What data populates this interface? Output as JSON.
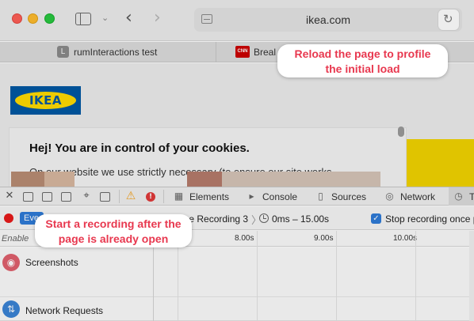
{
  "browser": {
    "url": "ikea.com",
    "icons": {
      "sidebar": "sidebar-icon",
      "back": "chevron-left-icon",
      "forward": "chevron-right-icon",
      "reload": "reload-icon",
      "page": "page-menu-icon"
    }
  },
  "tabs": [
    {
      "favicon_letter": "L",
      "label": "rumInteractions test"
    },
    {
      "favicon_text": "CNN",
      "label": "Breal"
    }
  ],
  "page": {
    "logo_text": "IKEA",
    "cookie_title": "Hej! You are in control of your cookies.",
    "cookie_body": "On our website we use strictly necessary (to ensure our site works",
    "brand_colors": {
      "blue": "#0058a3",
      "yellow": "#ffdb00"
    }
  },
  "inspector": {
    "tabs": [
      {
        "label": "Elements",
        "icon": "elements-icon"
      },
      {
        "label": "Console",
        "icon": "console-icon"
      },
      {
        "label": "Sources",
        "icon": "sources-icon"
      },
      {
        "label": "Network",
        "icon": "network-icon"
      },
      {
        "label": "T",
        "icon": "timelines-icon",
        "selected": true
      }
    ]
  },
  "timeline": {
    "events_label": "Eve",
    "recording_name": "ine Recording 3",
    "time_range": "0ms – 15.00s",
    "stop_recording_label": "Stop recording once p",
    "stop_recording_checked": true,
    "enable_label": "Enable",
    "ticks": [
      "8.00s",
      "9.00s",
      "10.00s"
    ],
    "rows": [
      {
        "label": "Screenshots",
        "icon": "camera-icon"
      },
      {
        "label": "Network Requests",
        "icon": "network-requests-icon"
      }
    ]
  },
  "callouts": {
    "reload": "Reload the page to profile the initial load",
    "start_recording": "Start a recording after the page is already open"
  }
}
